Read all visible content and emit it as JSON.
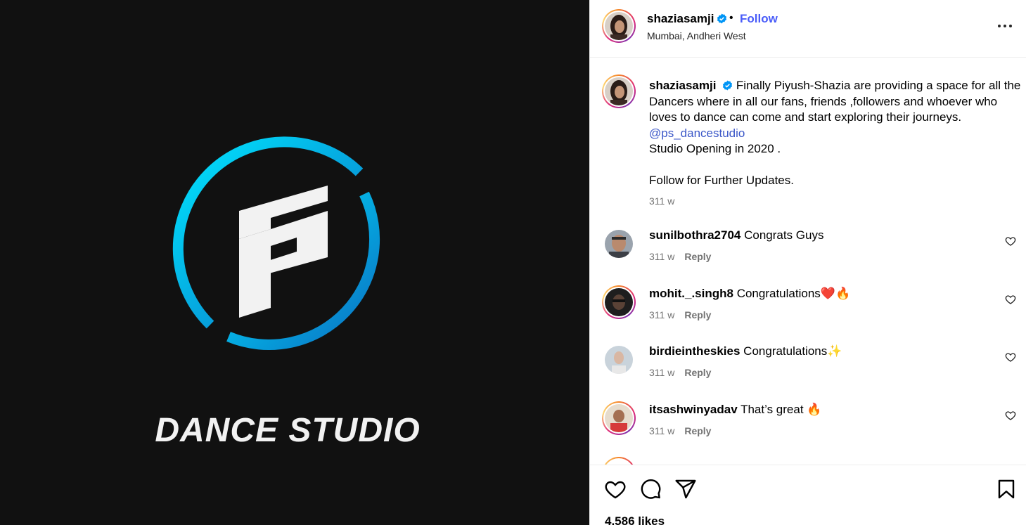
{
  "post": {
    "image": {
      "brand_text": "DANCE STUDIO",
      "logo_icon": "ps-monogram-logo",
      "ring_colors": [
        "#00e5ff",
        "#0a6fc2"
      ],
      "background": "#111111"
    },
    "header": {
      "username": "shaziasamji",
      "separator": "•",
      "follow_label": "Follow",
      "location": "Mumbai, Andheri West",
      "more_icon": "more-horizontal-icon"
    },
    "caption": {
      "username": "shaziasamji",
      "text": "Finally Piyush-Shazia are providing a space for all the Dancers where in all our fans, friends ,followers and whoever who loves to dance can come and start exploring their journeys.",
      "mention": "@ps_dancestudio",
      "line2": "Studio Opening in 2020 .",
      "line3": "Follow for Further Updates.",
      "time": "311 w"
    },
    "comments": [
      {
        "username": "sunilbothra2704",
        "text": "Congrats Guys",
        "time": "311 w",
        "reply_label": "Reply"
      },
      {
        "username": "mohit._.singh8",
        "text": "Congratulations❤️🔥",
        "time": "311 w",
        "reply_label": "Reply"
      },
      {
        "username": "birdieintheskies",
        "text": "Congratulations✨",
        "time": "311 w",
        "reply_label": "Reply"
      },
      {
        "username": "itsashwinyadav",
        "text": "That’s great 🔥",
        "time": "311 w",
        "reply_label": "Reply"
      }
    ],
    "actions": {
      "icons": [
        "heart-icon",
        "comment-icon",
        "share-icon",
        "bookmark-icon"
      ],
      "likes": "4,586 likes"
    },
    "colors": {
      "follow": "#4a5df9",
      "mention": "#3b57c8",
      "verified": "#0095f6",
      "secondary_text": "#737373"
    }
  }
}
